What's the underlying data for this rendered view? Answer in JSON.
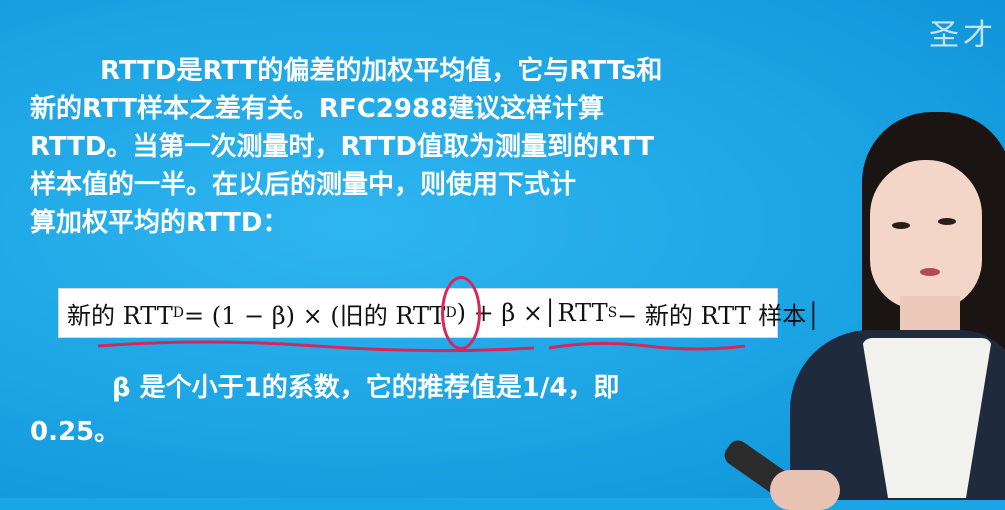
{
  "logo_text": "圣才",
  "paragraph_lines": [
    "RTTD是RTT的偏差的加权平均值，它与RTTs和",
    "新的RTT样本之差有关。RFC2988建议这样计算",
    "RTTD。当第一次测量时，RTTD值取为测量到的RTT",
    "样本值的一半。在以后的测量中，则使用下式计",
    "算加权平均的RTTD："
  ],
  "formula": {
    "part1": "新的 RTT",
    "sub1": "D",
    "part2": " = (1 − β) × (旧的 RTT",
    "sub2": "D",
    "part3": ") + β × ",
    "part4": "│RTT",
    "sub3": "S",
    "part5": " − 新的 RTT 样本│"
  },
  "note_lines": [
    "β 是个小于1的系数，它的推荐值是1/4，即",
    "0.25。"
  ],
  "colors": {
    "background": "#1aa6e6",
    "annotation": "#d7265b",
    "text": "#ffffff"
  }
}
